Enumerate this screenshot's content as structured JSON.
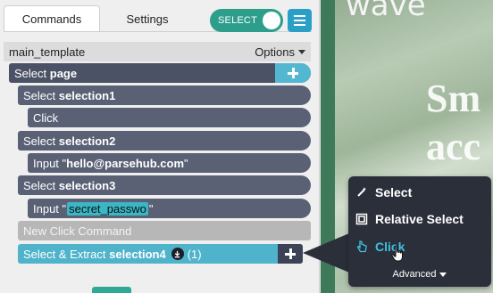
{
  "tabs": [
    {
      "label": "Commands",
      "active": true
    },
    {
      "label": "Settings",
      "active": false
    }
  ],
  "toggle": {
    "label": "SELECT",
    "on": true
  },
  "template_row": {
    "name": "main_template",
    "options_label": "Options"
  },
  "commands": [
    {
      "prefix": "Select ",
      "bold": "page"
    },
    {
      "prefix": "Select ",
      "bold": "selection1"
    },
    {
      "prefix": "Click"
    },
    {
      "prefix": "Select ",
      "bold": "selection2"
    },
    {
      "prefix": "Input \"",
      "bold": "hello@parsehub.com",
      "suffix": "\""
    },
    {
      "prefix": "Select ",
      "bold": "selection3"
    },
    {
      "prefix": "Input \"",
      "field": "secret_passwo",
      "suffix": "\""
    },
    {
      "prefix": "New Click Command"
    },
    {
      "prefix": "Select & Extract ",
      "bold": "selection4",
      "count": "(1)"
    }
  ],
  "preview": {
    "logo": "wave",
    "hero_lines": [
      "Sm",
      "acc"
    ]
  },
  "popup": {
    "items": [
      {
        "label": "Select",
        "icon": "wand-icon"
      },
      {
        "label": "Relative Select",
        "icon": "relative-select-icon"
      },
      {
        "label": "Click",
        "icon": "pointer-icon",
        "active": true
      }
    ],
    "advanced_label": "Advanced"
  },
  "colors": {
    "dark_command": "#4c5265",
    "accent_teal": "#4fb3cb",
    "toggle_green": "#2e9e8c",
    "menu_blue": "#2a9fc8",
    "popup_bg": "#2b2f3a",
    "active_item": "#3cc0e0"
  }
}
